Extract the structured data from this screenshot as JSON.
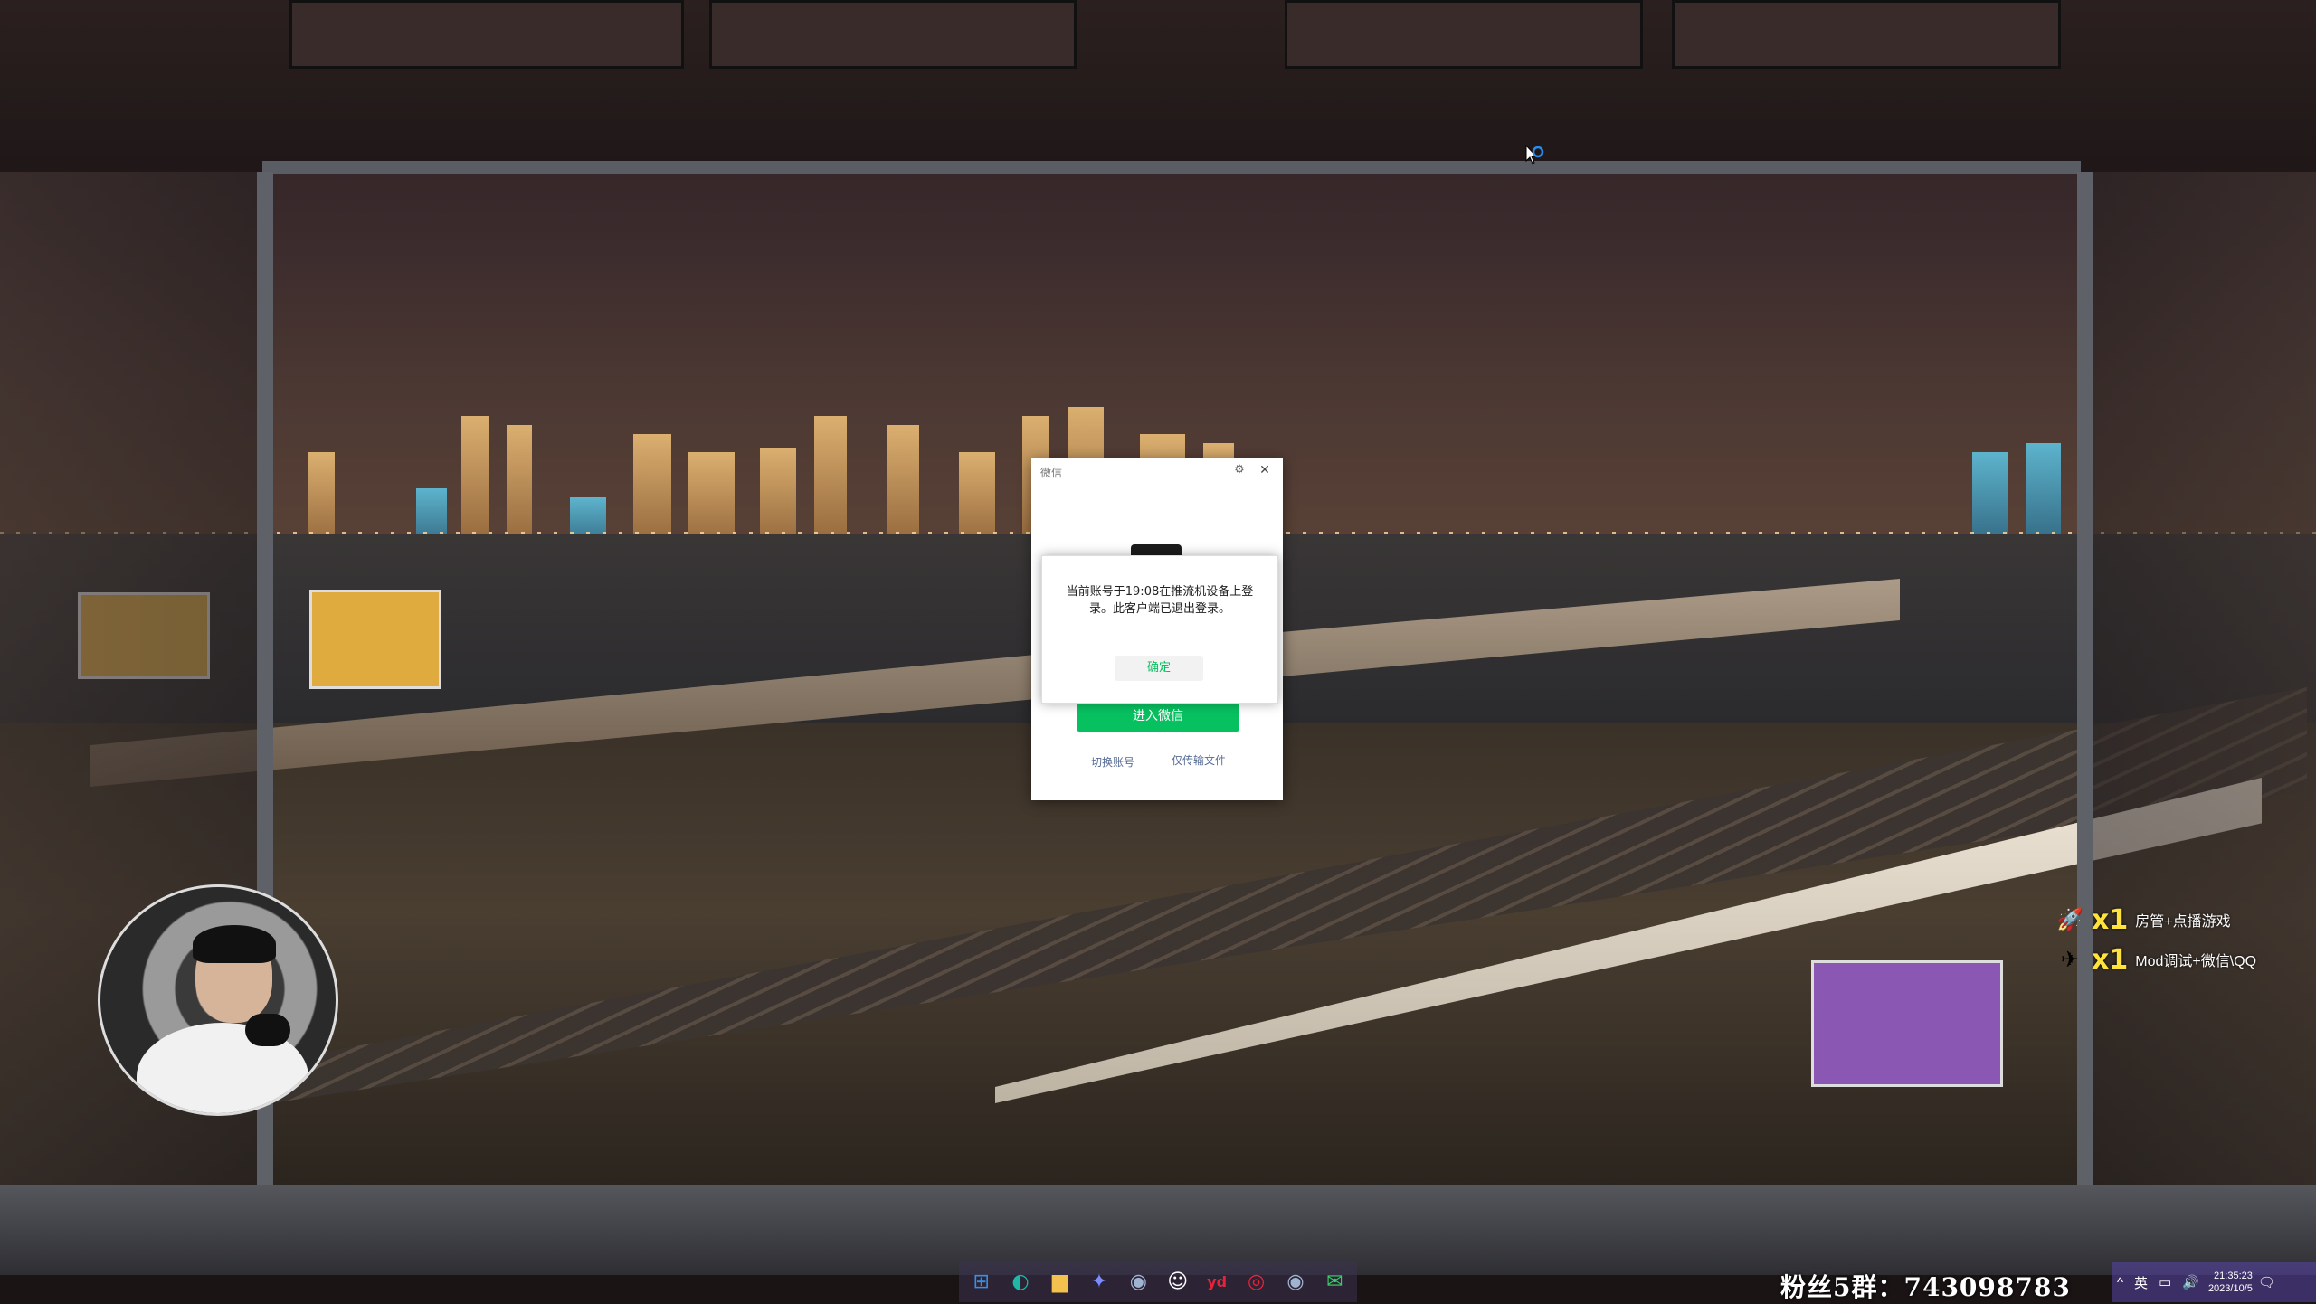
{
  "wechat_window": {
    "title": "微信",
    "enter_button": "进入微信",
    "switch_account": "切换账号",
    "transfer_only": "仅传输文件",
    "accent_color": "#07c160",
    "link_color": "#576b95"
  },
  "alert": {
    "message": "当前账号于19:08在推流机设备上登录。此客户端已退出登录。",
    "confirm_label": "确定"
  },
  "overlay": {
    "gifts": [
      {
        "icon": "rocket-gift-icon",
        "count": "x1",
        "text": "房管+点播游戏"
      },
      {
        "icon": "plane-gift-icon",
        "count": "x1",
        "text": "Mod调试+微信\\QQ"
      }
    ],
    "fan_group": "粉丝5群：743098783"
  },
  "taskbar": {
    "apps": [
      {
        "name": "start-icon",
        "glyph": "⊞",
        "color": "#3a8ee6"
      },
      {
        "name": "edge-icon",
        "glyph": "◐",
        "color": "#1fb7a6"
      },
      {
        "name": "file-explorer-icon",
        "glyph": "▆",
        "color": "#f2c14e"
      },
      {
        "name": "app-icon",
        "glyph": "✦",
        "color": "#7a8cff"
      },
      {
        "name": "steam-icon",
        "glyph": "◉",
        "color": "#9fb4d0"
      },
      {
        "name": "qq-icon",
        "glyph": "☺",
        "color": "#ffffff"
      },
      {
        "name": "youdao-icon",
        "glyph": "yd",
        "color": "#e8223a"
      },
      {
        "name": "netease-music-icon",
        "glyph": "◎",
        "color": "#e8223a"
      },
      {
        "name": "steam2-icon",
        "glyph": "◉",
        "color": "#9fb4d0"
      },
      {
        "name": "wechat-icon",
        "glyph": "✉",
        "color": "#3ad36b"
      }
    ],
    "tray": {
      "chevron": "^",
      "ime": "英",
      "time": "21:35:23",
      "date": "2023/10/5"
    }
  }
}
